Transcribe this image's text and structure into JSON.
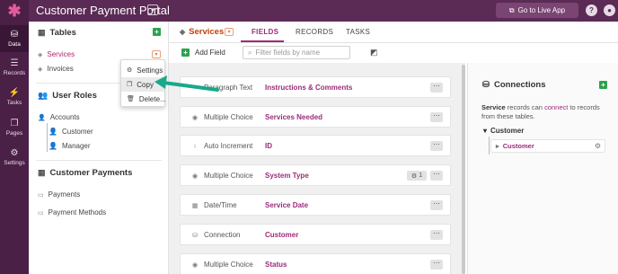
{
  "app": {
    "title": "Customer Payment Portal",
    "go_live_label": "Go to Live App"
  },
  "rail": [
    {
      "label": "Data",
      "icon": "data-icon"
    },
    {
      "label": "Records",
      "icon": "records-icon"
    },
    {
      "label": "Tasks",
      "icon": "tasks-icon"
    },
    {
      "label": "Pages",
      "icon": "pages-icon"
    },
    {
      "label": "Settings",
      "icon": "settings-icon"
    }
  ],
  "sidebar": {
    "tables_heading": "Tables",
    "tables": [
      "Services",
      "Invoices"
    ],
    "user_roles_heading": "User Roles",
    "accounts": "Accounts",
    "account_children": [
      "Customer",
      "Manager"
    ],
    "payments_heading": "Customer Payments",
    "payments": [
      "Payments",
      "Payment Methods"
    ]
  },
  "context_menu": {
    "settings": "Settings",
    "copy": "Copy",
    "delete": "Delete..."
  },
  "header": {
    "table_name": "Services",
    "tabs": [
      "FIELDS",
      "RECORDS",
      "TASKS"
    ]
  },
  "toolbar": {
    "add_field": "Add Field",
    "filter_placeholder": "Filter fields by name"
  },
  "fields": [
    {
      "type": "Paragraph Text",
      "name": "Instructions & Comments",
      "icon": "paragraph-icon"
    },
    {
      "type": "Multiple Choice",
      "name": "Services Needed",
      "icon": "choice-icon"
    },
    {
      "type": "Auto Increment",
      "name": "ID",
      "icon": "increment-icon"
    },
    {
      "type": "Multiple Choice",
      "name": "System Type",
      "icon": "choice-icon",
      "badge": "1"
    },
    {
      "type": "Date/Time",
      "name": "Service Date",
      "icon": "calendar-icon"
    },
    {
      "type": "Connection",
      "name": "Customer",
      "icon": "connection-icon"
    },
    {
      "type": "Multiple Choice",
      "name": "Status",
      "icon": "choice-icon"
    }
  ],
  "connections": {
    "title": "Connections",
    "desc_bold": "Service",
    "desc_mid": " records can ",
    "desc_link": "connect",
    "desc_end": " to records from these tables.",
    "group": "Customer",
    "item": "Customer"
  },
  "colors": {
    "brand": "#5b2a55",
    "accent": "#9b2c7a",
    "green": "#2ca24d",
    "table_title": "#c2410c"
  }
}
